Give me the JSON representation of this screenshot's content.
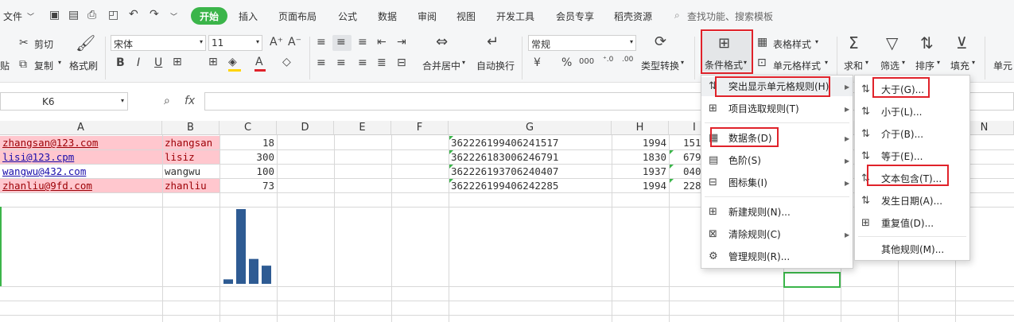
{
  "menubar": {
    "file": "文件",
    "tabs": [
      "开始",
      "插入",
      "页面布局",
      "公式",
      "数据",
      "审阅",
      "视图",
      "开发工具",
      "会员专享",
      "稻壳资源"
    ],
    "search": "查找功能、搜索模板"
  },
  "ribbon": {
    "cut": "剪切",
    "copy": "复制",
    "painter": "格式刷",
    "paste_fragment": "贴",
    "font_name": "宋体",
    "font_size": "11",
    "merge": "合并居中",
    "wrap": "自动换行",
    "number_format": "常规",
    "type_convert": "类型转换",
    "cond_format": "条件格式",
    "table_style": "表格样式",
    "cell_style": "单元格样式",
    "sum": "求和",
    "filter": "筛选",
    "sort": "排序",
    "fill": "填充",
    "cell_fragment": "单元"
  },
  "formula_bar": {
    "name_box": "K6",
    "fx": "fx"
  },
  "sheet": {
    "columns": [
      "A",
      "B",
      "C",
      "D",
      "E",
      "F",
      "G",
      "H",
      "I",
      "N"
    ],
    "rows": [
      {
        "a": "zhangsan@123.com",
        "b": "zhangsan",
        "c": "18",
        "g": "362226199406241517",
        "h": "1994",
        "i": "151"
      },
      {
        "a": "lisi@123.cpm",
        "b": "lisiz",
        "c": "300",
        "g": "362226183006246791",
        "h": "1830",
        "i": "679"
      },
      {
        "a": "wangwu@432.com",
        "b": "wangwu",
        "c": "100",
        "g": "362226193706240407",
        "h": "1937",
        "i": "040"
      },
      {
        "a": "zhanliu@9fd.com",
        "b": "zhanliu",
        "c": "73",
        "g": "362226199406242285",
        "h": "1994",
        "i": "228"
      }
    ],
    "sparkline_values": [
      18,
      300,
      100,
      73
    ],
    "highlight_color": "#ffc7ce"
  },
  "menu1": {
    "items": [
      "突出显示单元格规则(H)",
      "项目选取规则(T)",
      "数据条(D)",
      "色阶(S)",
      "图标集(I)",
      "新建规则(N)...",
      "清除规则(C)",
      "管理规则(R)..."
    ]
  },
  "menu2": {
    "items": [
      "大于(G)...",
      "小于(L)...",
      "介于(B)...",
      "等于(E)...",
      "文本包含(T)...",
      "发生日期(A)...",
      "重复值(D)...",
      "其他规则(M)..."
    ]
  },
  "colors": {
    "accent_green": "#3bb54a",
    "red_highlight": "#e0222a",
    "bar_blue": "#2e5b93"
  }
}
